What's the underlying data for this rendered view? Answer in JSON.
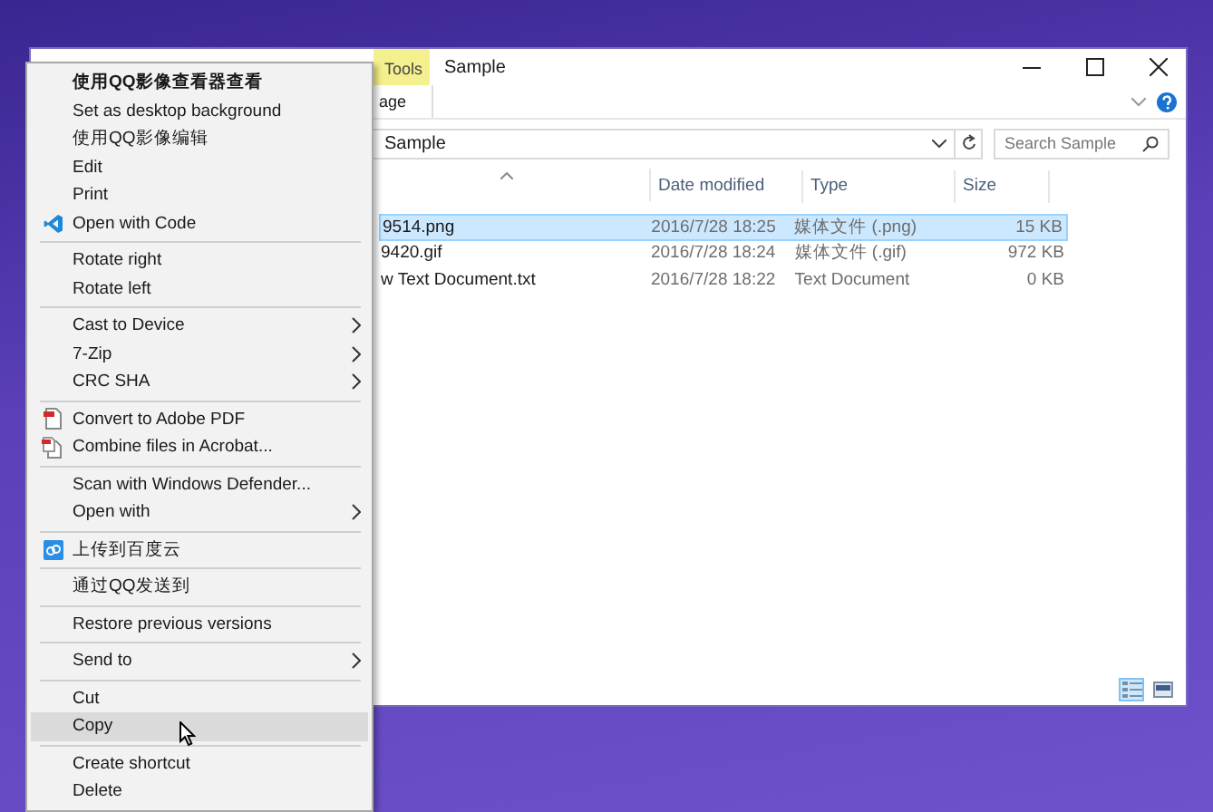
{
  "explorer": {
    "title": "Sample",
    "tools_tab": "Tools",
    "ribbon_tab": "age",
    "address": "Sample",
    "search": {
      "placeholder": "Search Sample"
    },
    "columns": [
      "Date modified",
      "Type",
      "Size"
    ],
    "rows": [
      {
        "name": "9514.png",
        "date": "2016/7/28 18:25",
        "type": "媒体文件 (.png)",
        "size": "15 KB",
        "selected": true
      },
      {
        "name": "9420.gif",
        "date": "2016/7/28 18:24",
        "type": "媒体文件 (.gif)",
        "size": "972 KB",
        "selected": false
      },
      {
        "name": "w Text Document.txt",
        "date": "2016/7/28 18:22",
        "type": "Text Document",
        "size": "0 KB",
        "selected": false
      }
    ],
    "views": [
      {
        "kind": "details",
        "selected": true
      },
      {
        "kind": "large",
        "selected": false
      }
    ]
  },
  "menu": {
    "groups": [
      {
        "items": [
          {
            "label": "使用QQ影像查看器查看",
            "default": true,
            "submenu": false,
            "selected": false
          },
          {
            "label": "Set as desktop background",
            "default": false,
            "submenu": false,
            "selected": false
          },
          {
            "label": "使用QQ影像编辑",
            "default": false,
            "submenu": false,
            "selected": false
          },
          {
            "label": "Edit",
            "default": false,
            "submenu": false,
            "selected": false
          },
          {
            "label": "Print",
            "default": false,
            "submenu": false,
            "selected": false
          },
          {
            "label": "Open with Code",
            "kind": "code",
            "default": false,
            "submenu": false,
            "selected": false
          }
        ]
      },
      {
        "items": [
          {
            "label": "Rotate right",
            "default": false,
            "submenu": false,
            "selected": false
          },
          {
            "label": "Rotate left",
            "default": false,
            "submenu": false,
            "selected": false
          }
        ]
      },
      {
        "items": [
          {
            "label": "Cast to Device",
            "default": false,
            "submenu": true,
            "selected": false
          },
          {
            "label": "7-Zip",
            "default": false,
            "submenu": true,
            "selected": false
          },
          {
            "label": "CRC SHA",
            "default": false,
            "submenu": true,
            "selected": false
          }
        ]
      },
      {
        "items": [
          {
            "label": "Convert to Adobe PDF",
            "kind": "pdf",
            "default": false,
            "submenu": false,
            "selected": false
          },
          {
            "label": "Combine files in Acrobat...",
            "kind": "combine",
            "default": false,
            "submenu": false,
            "selected": false
          }
        ]
      },
      {
        "items": [
          {
            "label": "Scan with Windows Defender...",
            "default": false,
            "submenu": false,
            "selected": false
          },
          {
            "label": "Open with",
            "default": false,
            "submenu": true,
            "selected": false
          }
        ]
      },
      {
        "items": [
          {
            "label": "上传到百度云",
            "kind": "upload",
            "default": false,
            "submenu": false,
            "selected": false
          }
        ]
      },
      {
        "items": [
          {
            "label": "通过QQ发送到",
            "default": false,
            "submenu": false,
            "selected": false
          }
        ]
      },
      {
        "items": [
          {
            "label": "Restore previous versions",
            "default": false,
            "submenu": false,
            "selected": false
          }
        ]
      },
      {
        "items": [
          {
            "label": "Send to",
            "default": false,
            "submenu": true,
            "selected": false
          }
        ]
      },
      {
        "items": [
          {
            "label": "Cut",
            "default": false,
            "submenu": false,
            "selected": false
          },
          {
            "label": "Copy",
            "default": false,
            "submenu": false,
            "selected": true
          }
        ]
      },
      {
        "items": [
          {
            "label": "Create shortcut",
            "default": false,
            "submenu": false,
            "selected": false
          },
          {
            "label": "Delete",
            "default": false,
            "submenu": false,
            "selected": false
          }
        ]
      }
    ]
  }
}
